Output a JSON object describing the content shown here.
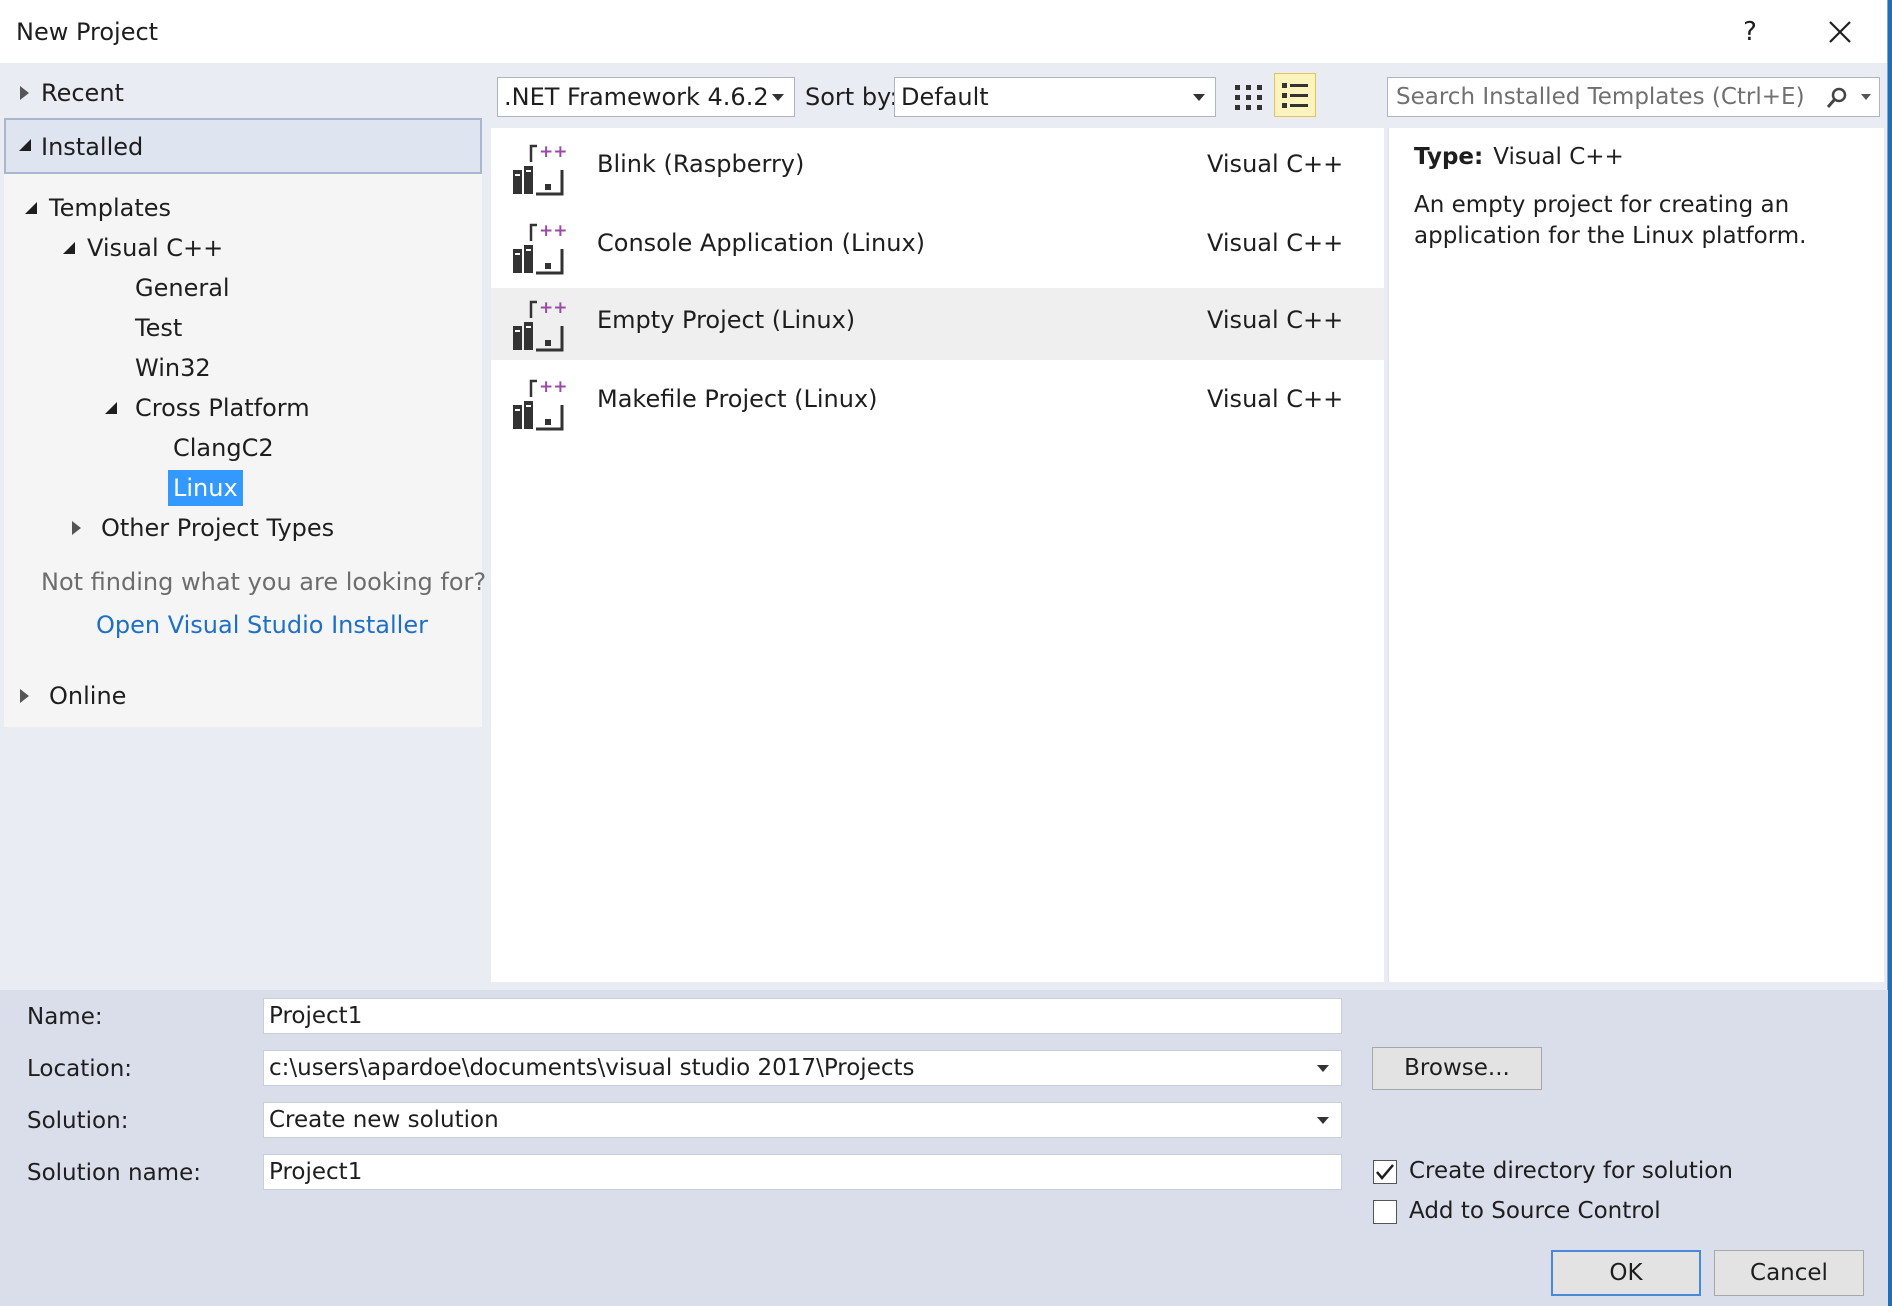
{
  "window": {
    "title": "New Project",
    "help_label": "?"
  },
  "nav": {
    "recent": "Recent",
    "installed": "Installed",
    "templates": "Templates",
    "visual_cpp": "Visual C++",
    "general": "General",
    "test": "Test",
    "win32": "Win32",
    "cross_platform": "Cross Platform",
    "clangc2": "ClangC2",
    "linux": "Linux",
    "other_types": "Other Project Types",
    "not_finding": "Not finding what you are looking for?",
    "installer_link": "Open Visual Studio Installer",
    "online": "Online"
  },
  "toolbar": {
    "framework": ".NET Framework 4.6.2",
    "sort_label": "Sort by:",
    "sort_value": "Default",
    "search_placeholder": "Search Installed Templates (Ctrl+E)"
  },
  "templates": [
    {
      "name": "Blink (Raspberry)",
      "lang": "Visual C++"
    },
    {
      "name": "Console Application (Linux)",
      "lang": "Visual C++"
    },
    {
      "name": "Empty Project (Linux)",
      "lang": "Visual C++"
    },
    {
      "name": "Makefile Project (Linux)",
      "lang": "Visual C++"
    }
  ],
  "details": {
    "type_label": "Type:",
    "type_value": "Visual C++",
    "description": "An empty project for creating an application for the Linux platform."
  },
  "form": {
    "name_label": "Name:",
    "name_value": "Project1",
    "location_label": "Location:",
    "location_value": "c:\\users\\apardoe\\documents\\visual studio 2017\\Projects",
    "solution_label": "Solution:",
    "solution_value": "Create new solution",
    "solution_name_label": "Solution name:",
    "solution_name_value": "Project1",
    "browse_label": "Browse...",
    "create_dir_label": "Create directory for solution",
    "source_control_label": "Add to Source Control",
    "ok_label": "OK",
    "cancel_label": "Cancel"
  },
  "colors": {
    "accent": "#3399ff",
    "link": "#1e6fc8",
    "plus": "#9b4aa8"
  }
}
